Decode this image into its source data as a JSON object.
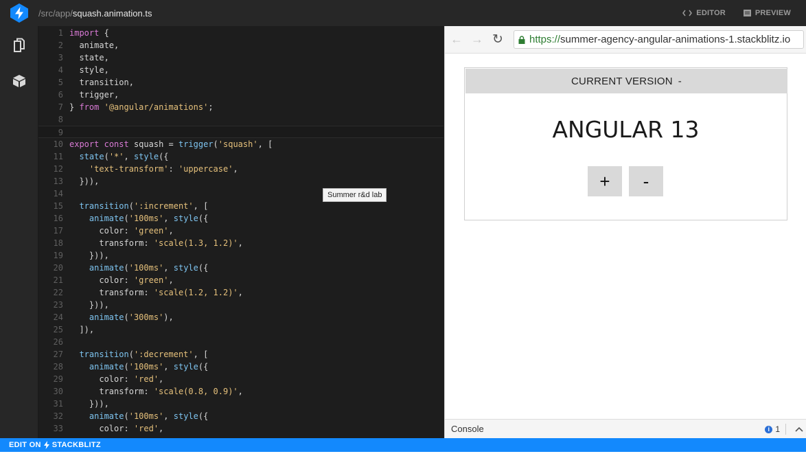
{
  "topbar": {
    "path_prefix": "/src/app/",
    "file_name": "squash.animation.ts",
    "editor_label": "EDITOR",
    "preview_label": "PREVIEW"
  },
  "activity": {
    "items": [
      "files-icon",
      "packages-icon"
    ]
  },
  "editor": {
    "active_line": 9,
    "tooltip": "Summer r&d lab",
    "lines": [
      {
        "n": "1",
        "tokens": [
          [
            "kw",
            "import"
          ],
          [
            "p",
            " {"
          ]
        ]
      },
      {
        "n": "2",
        "tokens": [
          [
            "p",
            "  animate,"
          ]
        ]
      },
      {
        "n": "3",
        "tokens": [
          [
            "p",
            "  state,"
          ]
        ]
      },
      {
        "n": "4",
        "tokens": [
          [
            "p",
            "  style,"
          ]
        ]
      },
      {
        "n": "5",
        "tokens": [
          [
            "p",
            "  transition,"
          ]
        ]
      },
      {
        "n": "6",
        "tokens": [
          [
            "p",
            "  trigger,"
          ]
        ]
      },
      {
        "n": "7",
        "tokens": [
          [
            "p",
            "} "
          ],
          [
            "kw",
            "from"
          ],
          [
            "p",
            " "
          ],
          [
            "str",
            "'@angular/animations'"
          ],
          [
            "p",
            ";"
          ]
        ]
      },
      {
        "n": "8",
        "tokens": []
      },
      {
        "n": "9",
        "tokens": []
      },
      {
        "n": "10",
        "tokens": [
          [
            "kw",
            "export"
          ],
          [
            "p",
            " "
          ],
          [
            "kw",
            "const"
          ],
          [
            "p",
            " squash = "
          ],
          [
            "fn",
            "trigger"
          ],
          [
            "p",
            "("
          ],
          [
            "str",
            "'squash'"
          ],
          [
            "p",
            ", ["
          ]
        ]
      },
      {
        "n": "11",
        "tokens": [
          [
            "p",
            "  "
          ],
          [
            "fn",
            "state"
          ],
          [
            "p",
            "("
          ],
          [
            "str",
            "'*'"
          ],
          [
            "p",
            ", "
          ],
          [
            "fn",
            "style"
          ],
          [
            "p",
            "({"
          ]
        ]
      },
      {
        "n": "12",
        "tokens": [
          [
            "p",
            "    "
          ],
          [
            "str",
            "'text-transform'"
          ],
          [
            "p",
            ": "
          ],
          [
            "str",
            "'uppercase'"
          ],
          [
            "p",
            ","
          ]
        ]
      },
      {
        "n": "13",
        "tokens": [
          [
            "p",
            "  })),"
          ]
        ]
      },
      {
        "n": "14",
        "tokens": []
      },
      {
        "n": "15",
        "tokens": [
          [
            "p",
            "  "
          ],
          [
            "fn",
            "transition"
          ],
          [
            "p",
            "("
          ],
          [
            "str",
            "':increment'"
          ],
          [
            "p",
            ", ["
          ]
        ]
      },
      {
        "n": "16",
        "tokens": [
          [
            "p",
            "    "
          ],
          [
            "fn",
            "animate"
          ],
          [
            "p",
            "("
          ],
          [
            "str",
            "'100ms'"
          ],
          [
            "p",
            ", "
          ],
          [
            "fn",
            "style"
          ],
          [
            "p",
            "({"
          ]
        ]
      },
      {
        "n": "17",
        "tokens": [
          [
            "p",
            "      color: "
          ],
          [
            "str",
            "'green'"
          ],
          [
            "p",
            ","
          ]
        ]
      },
      {
        "n": "18",
        "tokens": [
          [
            "p",
            "      transform: "
          ],
          [
            "str",
            "'scale(1.3, 1.2)'"
          ],
          [
            "p",
            ","
          ]
        ]
      },
      {
        "n": "19",
        "tokens": [
          [
            "p",
            "    })),"
          ]
        ]
      },
      {
        "n": "20",
        "tokens": [
          [
            "p",
            "    "
          ],
          [
            "fn",
            "animate"
          ],
          [
            "p",
            "("
          ],
          [
            "str",
            "'100ms'"
          ],
          [
            "p",
            ", "
          ],
          [
            "fn",
            "style"
          ],
          [
            "p",
            "({"
          ]
        ]
      },
      {
        "n": "21",
        "tokens": [
          [
            "p",
            "      color: "
          ],
          [
            "str",
            "'green'"
          ],
          [
            "p",
            ","
          ]
        ]
      },
      {
        "n": "22",
        "tokens": [
          [
            "p",
            "      transform: "
          ],
          [
            "str",
            "'scale(1.2, 1.2)'"
          ],
          [
            "p",
            ","
          ]
        ]
      },
      {
        "n": "23",
        "tokens": [
          [
            "p",
            "    })),"
          ]
        ]
      },
      {
        "n": "24",
        "tokens": [
          [
            "p",
            "    "
          ],
          [
            "fn",
            "animate"
          ],
          [
            "p",
            "("
          ],
          [
            "str",
            "'300ms'"
          ],
          [
            "p",
            "),"
          ]
        ]
      },
      {
        "n": "25",
        "tokens": [
          [
            "p",
            "  ]),"
          ]
        ]
      },
      {
        "n": "26",
        "tokens": []
      },
      {
        "n": "27",
        "tokens": [
          [
            "p",
            "  "
          ],
          [
            "fn",
            "transition"
          ],
          [
            "p",
            "("
          ],
          [
            "str",
            "':decrement'"
          ],
          [
            "p",
            ", ["
          ]
        ]
      },
      {
        "n": "28",
        "tokens": [
          [
            "p",
            "    "
          ],
          [
            "fn",
            "animate"
          ],
          [
            "p",
            "("
          ],
          [
            "str",
            "'100ms'"
          ],
          [
            "p",
            ", "
          ],
          [
            "fn",
            "style"
          ],
          [
            "p",
            "({"
          ]
        ]
      },
      {
        "n": "29",
        "tokens": [
          [
            "p",
            "      color: "
          ],
          [
            "str",
            "'red'"
          ],
          [
            "p",
            ","
          ]
        ]
      },
      {
        "n": "30",
        "tokens": [
          [
            "p",
            "      transform: "
          ],
          [
            "str",
            "'scale(0.8, 0.9)'"
          ],
          [
            "p",
            ","
          ]
        ]
      },
      {
        "n": "31",
        "tokens": [
          [
            "p",
            "    })),"
          ]
        ]
      },
      {
        "n": "32",
        "tokens": [
          [
            "p",
            "    "
          ],
          [
            "fn",
            "animate"
          ],
          [
            "p",
            "("
          ],
          [
            "str",
            "'100ms'"
          ],
          [
            "p",
            ", "
          ],
          [
            "fn",
            "style"
          ],
          [
            "p",
            "({"
          ]
        ]
      },
      {
        "n": "33",
        "tokens": [
          [
            "p",
            "      color: "
          ],
          [
            "str",
            "'red'"
          ],
          [
            "p",
            ","
          ]
        ]
      }
    ]
  },
  "preview": {
    "url_scheme": "https://",
    "url_host": "summer-agency-angular-animations-1.stackblitz.io",
    "card_header": "CURRENT VERSION",
    "card_header_suffix": "-",
    "version_text": "ANGULAR 13",
    "plus_label": "+",
    "minus_label": "-",
    "console_label": "Console",
    "console_count": "1"
  },
  "bottombar": {
    "left": "EDIT ON",
    "right": "STACKBLITZ"
  },
  "colors": {
    "accent": "#1389fd",
    "keyword": "#d97ad5",
    "string": "#e5c07b",
    "function": "#7ec4f0"
  }
}
